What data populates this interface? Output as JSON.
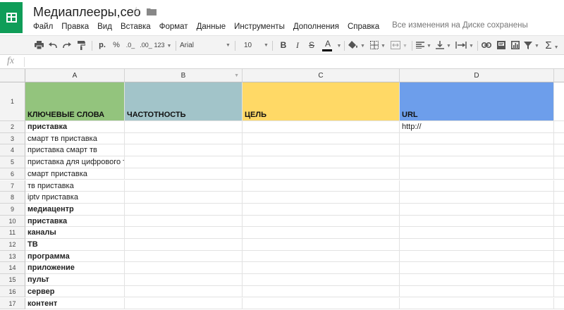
{
  "app": {
    "title": "Медиаплееры,сео",
    "menu": [
      "Файл",
      "Правка",
      "Вид",
      "Вставка",
      "Формат",
      "Данные",
      "Инструменты",
      "Дополнения",
      "Справка"
    ],
    "save_status": "Все изменения на Диске сохранены",
    "brand_color": "#0f9d58"
  },
  "toolbar": {
    "currency": "р.",
    "percent": "%",
    "decrease_decimals": ".0_",
    "increase_decimals": ".00_",
    "more_formats": "123",
    "font": "Arial",
    "font_size": "10",
    "bold": "B",
    "italic": "I",
    "strikethrough": "S",
    "text_color": "A",
    "icons": [
      "print-icon",
      "undo-icon",
      "redo-icon",
      "paint-format-icon",
      "fill-color-icon",
      "borders-icon",
      "merge-cells-icon",
      "align-left-icon",
      "valign-bottom-icon",
      "text-wrap-icon",
      "link-icon",
      "comment-icon",
      "chart-icon",
      "filter-icon",
      "sum-icon"
    ]
  },
  "formula_bar": {
    "label": "fx",
    "value": ""
  },
  "sheet": {
    "columns": [
      "A",
      "B",
      "C",
      "D"
    ],
    "header_colors": [
      "#93c47d",
      "#a2c4c9",
      "#ffd966",
      "#6d9eeb"
    ],
    "rows": [
      {
        "n": "1",
        "cells": [
          "КЛЮЧЕВЫЕ СЛОВА",
          "ЧАСТОТНОСТЬ",
          "ЦЕЛЬ",
          "URL"
        ]
      },
      {
        "n": "2",
        "cells": [
          "приставка",
          "",
          "",
          "http://"
        ],
        "bold": true
      },
      {
        "n": "3",
        "cells": [
          "смарт тв приставка",
          "",
          "",
          ""
        ]
      },
      {
        "n": "4",
        "cells": [
          "приставка смарт тв",
          "",
          "",
          ""
        ]
      },
      {
        "n": "5",
        "cells": [
          "приставка для цифрового тв",
          "",
          "",
          ""
        ]
      },
      {
        "n": "6",
        "cells": [
          "смарт приставка",
          "",
          "",
          ""
        ]
      },
      {
        "n": "7",
        "cells": [
          "тв приставка",
          "",
          "",
          ""
        ]
      },
      {
        "n": "8",
        "cells": [
          "iptv приставка",
          "",
          "",
          ""
        ]
      },
      {
        "n": "9",
        "cells": [
          "медиацентр",
          "",
          "",
          ""
        ],
        "bold": true
      },
      {
        "n": "10",
        "cells": [
          "приставка",
          "",
          "",
          ""
        ],
        "bold": true
      },
      {
        "n": "11",
        "cells": [
          "каналы",
          "",
          "",
          ""
        ],
        "bold": true
      },
      {
        "n": "12",
        "cells": [
          "ТВ",
          "",
          "",
          ""
        ],
        "bold": true
      },
      {
        "n": "13",
        "cells": [
          "программа",
          "",
          "",
          ""
        ],
        "bold": true
      },
      {
        "n": "14",
        "cells": [
          "приложение",
          "",
          "",
          ""
        ],
        "bold": true
      },
      {
        "n": "15",
        "cells": [
          "пульт",
          "",
          "",
          ""
        ],
        "bold": true
      },
      {
        "n": "16",
        "cells": [
          "сервер",
          "",
          "",
          ""
        ],
        "bold": true
      },
      {
        "n": "17",
        "cells": [
          "контент",
          "",
          "",
          ""
        ],
        "bold": true
      }
    ]
  }
}
